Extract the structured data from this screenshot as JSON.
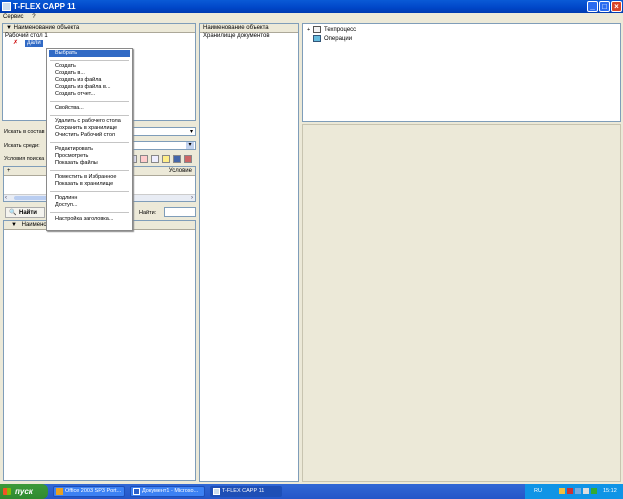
{
  "window": {
    "title": "T-FLEX CAPP 11",
    "min": "_",
    "max": "□",
    "close": "×"
  },
  "menubar": [
    "Сервис",
    "?"
  ],
  "left_top": {
    "header": "Наименование объекта",
    "desktop_label": "Рабочий стол 1",
    "selected_item": "дали"
  },
  "context_menu": {
    "selected": "Выбрать",
    "items": [
      "Создать",
      "Создать в...",
      "Создать из файла",
      "Создать из файла в...",
      "Создать отчет...",
      "Свойства...",
      "Удалить с рабочего стола",
      "Сохранить в хранилище",
      "Очистить Рабочий стол",
      "Редактировать",
      "Просмотреть",
      "Показать файлы",
      "Поместить в Избранное",
      "Показать в хранилище",
      "Подлинн",
      "Доступ...",
      "Настройка заголовка..."
    ]
  },
  "search": {
    "search_in_label": "Искать в состав",
    "search_among_label": "Искать среди:",
    "conditions_label": "Условия поиска",
    "col_plus": "+",
    "col_condition": "Условие",
    "find_button": "Найти",
    "found_label": "Найти:",
    "results_header": "Наименован"
  },
  "middle_panel": {
    "header": "Наименование объекта",
    "item": "Хранилище документов"
  },
  "right_tree": {
    "items": [
      "Техпроцесс",
      "Операции"
    ],
    "expander": "+"
  },
  "taskbar": {
    "start": "пуск",
    "buttons": [
      "Office 2003 SP3 Port...",
      "Документ1 - Microso...",
      "T-FLEX CAPP 11"
    ],
    "lang": "RU",
    "clock": "15:12"
  }
}
